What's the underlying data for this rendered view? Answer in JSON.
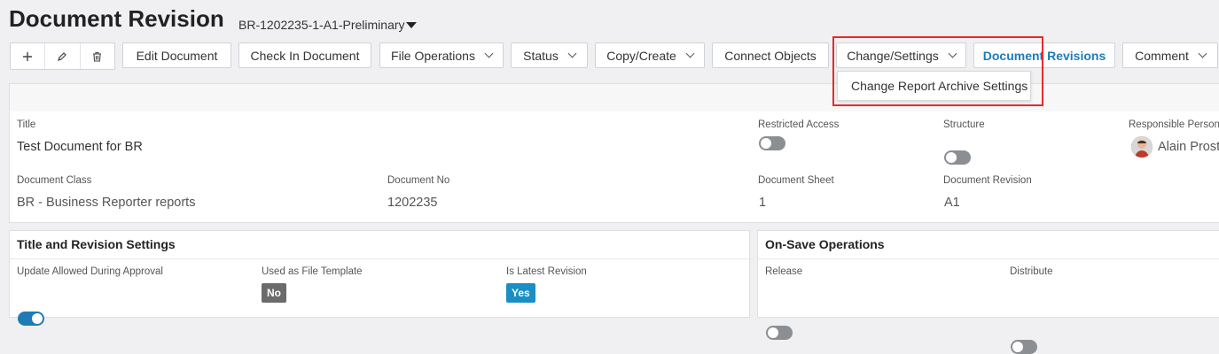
{
  "header": {
    "title": "Document Revision",
    "subtitle": "BR-1202235-1-A1-Preliminary"
  },
  "toolbar": {
    "icons": [
      "plus-icon",
      "pencil-icon",
      "trash-icon"
    ],
    "edit_document": "Edit Document",
    "check_in_document": "Check In Document",
    "file_operations": "File Operations",
    "status": "Status",
    "copy_create": "Copy/Create",
    "connect_objects": "Connect Objects",
    "change_settings": "Change/Settings",
    "document_revisions": "Document Revisions",
    "comment": "Comment"
  },
  "dropdown": {
    "item": "Change Report Archive Settings"
  },
  "main": {
    "title_label": "Title",
    "title_value": "Test Document for BR",
    "restricted_access_label": "Restricted Access",
    "structure_label": "Structure",
    "responsible_person_label": "Responsible Person",
    "responsible_person_value": "Alain Prost",
    "document_class_label": "Document Class",
    "document_class_value": "BR - Business Reporter reports",
    "document_no_label": "Document No",
    "document_no_value": "1202235",
    "document_sheet_label": "Document Sheet",
    "document_sheet_value": "1",
    "document_revision_label": "Document Revision",
    "document_revision_value": "A1"
  },
  "title_revision": {
    "heading": "Title and Revision Settings",
    "update_allowed_label": "Update Allowed During Approval",
    "used_as_template_label": "Used as File Template",
    "used_as_template_value": "No",
    "is_latest_label": "Is Latest Revision",
    "is_latest_value": "Yes"
  },
  "on_save": {
    "heading": "On-Save Operations",
    "release_label": "Release",
    "distribute_label": "Distribute"
  },
  "colors": {
    "accent": "#1f7bb6",
    "highlight": "#e52a2a",
    "no_badge": "#6b6b6b",
    "yes_badge": "#1a8fc4"
  }
}
